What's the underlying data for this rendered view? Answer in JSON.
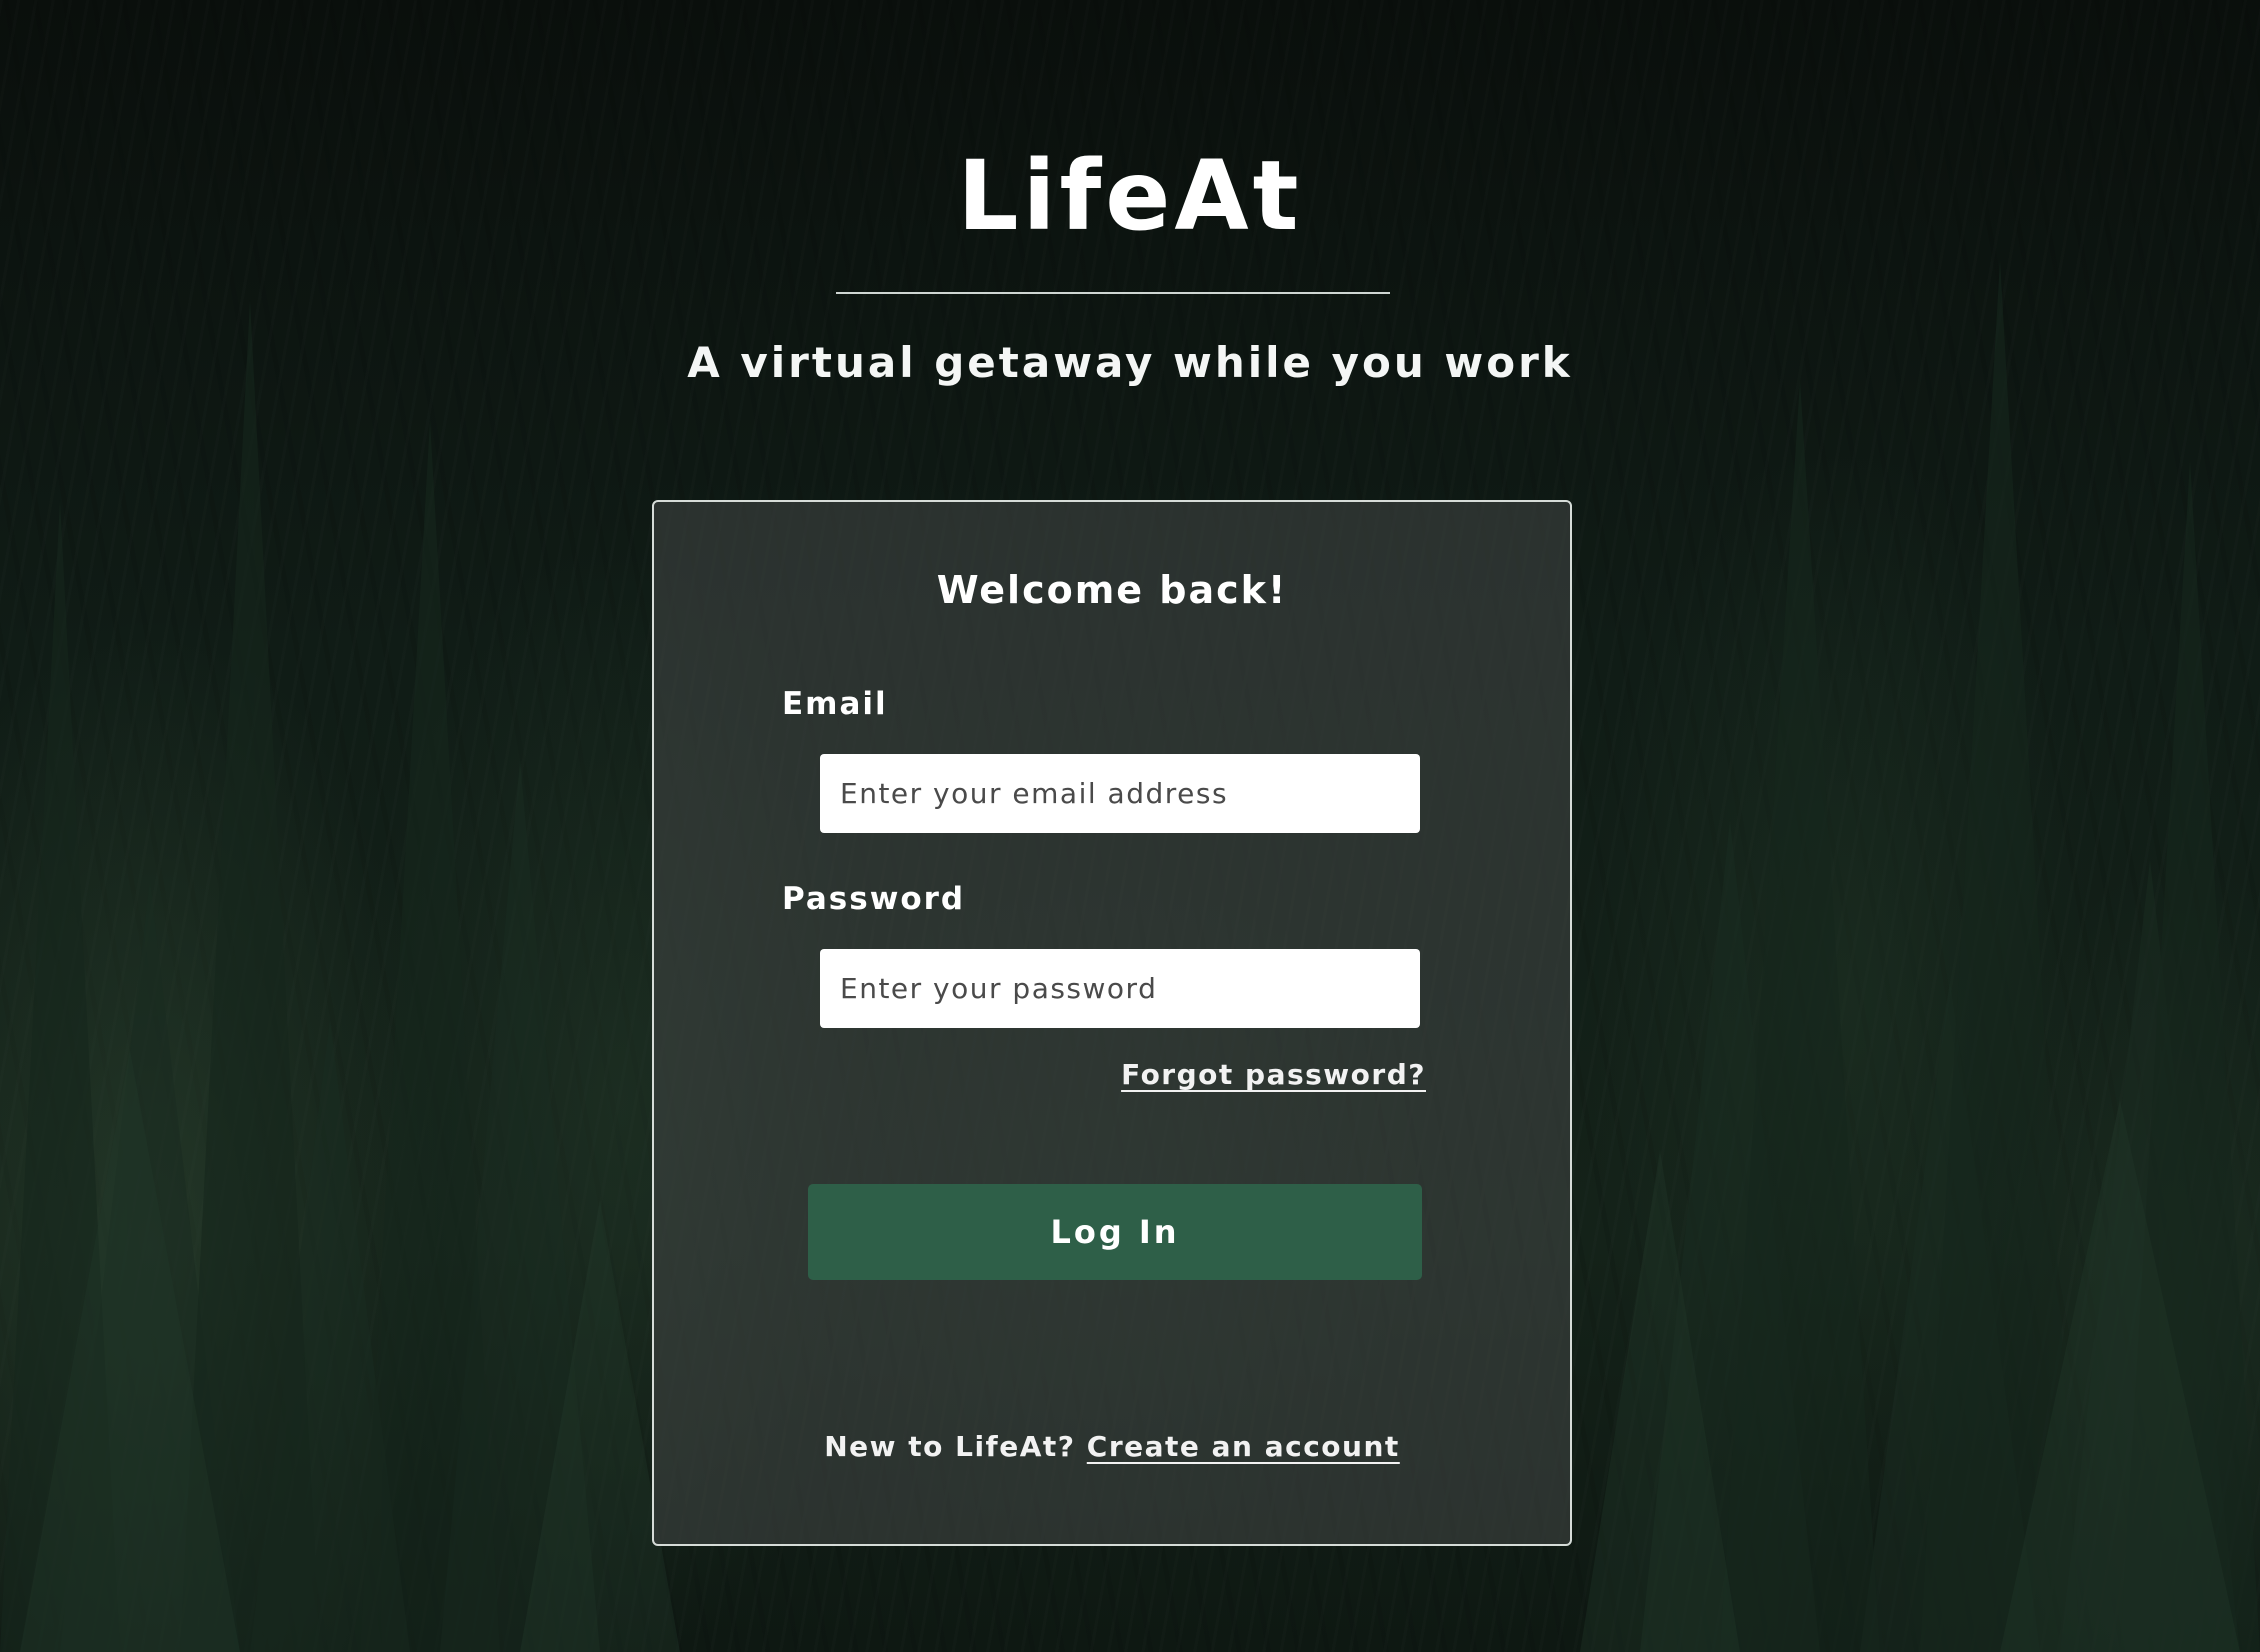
{
  "header": {
    "app_title": "LifeAt",
    "tagline": "A virtual getaway while you work"
  },
  "login_card": {
    "heading": "Welcome back!",
    "email": {
      "label": "Email",
      "placeholder": "Enter your email address",
      "value": ""
    },
    "password": {
      "label": "Password",
      "placeholder": "Enter your password",
      "value": ""
    },
    "forgot_password_label": "Forgot password?",
    "login_button_label": "Log In",
    "signup_prompt": "New to LifeAt?",
    "signup_link_label": "Create an account"
  },
  "theme": {
    "accent": "#2e5f48",
    "background": "#0f1a14"
  }
}
